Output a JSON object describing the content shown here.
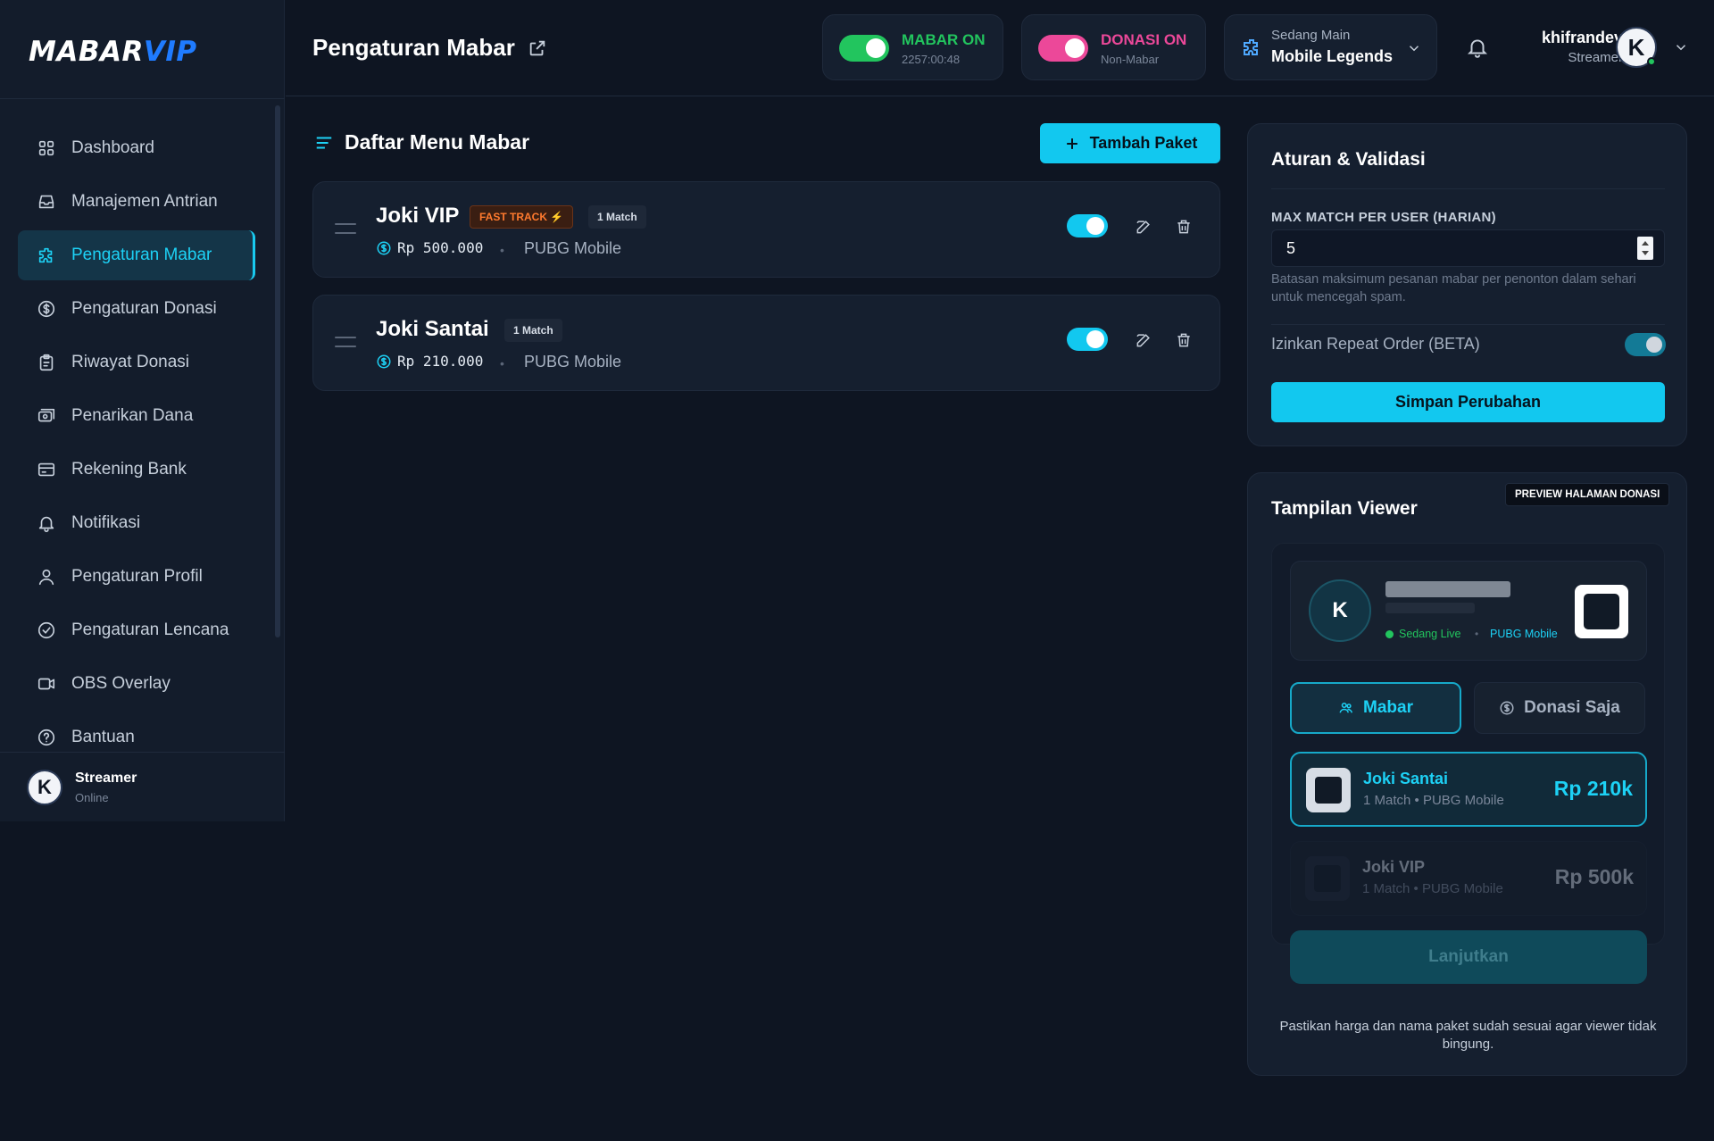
{
  "logo": {
    "part1": "MABAR",
    "part2": "VIP"
  },
  "sidebar": {
    "items": [
      {
        "label": "Dashboard",
        "icon": "grid-icon"
      },
      {
        "label": "Manajemen Antrian",
        "icon": "inbox-icon"
      },
      {
        "label": "Pengaturan Mabar",
        "icon": "puzzle-icon",
        "active": true
      },
      {
        "label": "Pengaturan Donasi",
        "icon": "dollar-circle-icon"
      },
      {
        "label": "Riwayat Donasi",
        "icon": "clipboard-icon"
      },
      {
        "label": "Penarikan Dana",
        "icon": "cash-icon"
      },
      {
        "label": "Rekening Bank",
        "icon": "card-icon"
      },
      {
        "label": "Notifikasi",
        "icon": "bell-icon"
      },
      {
        "label": "Pengaturan Profil",
        "icon": "user-icon"
      },
      {
        "label": "Pengaturan Lencana",
        "icon": "badge-check-icon"
      },
      {
        "label": "OBS Overlay",
        "icon": "video-icon"
      },
      {
        "label": "Bantuan",
        "icon": "help-icon"
      }
    ],
    "footer": {
      "avatar": "K",
      "name": "Streamer",
      "status": "Online"
    }
  },
  "header": {
    "title": "Pengaturan Mabar",
    "mabar": {
      "title": "MABAR ON",
      "sub": "2257:00:48",
      "color": "#22c55e"
    },
    "donasi": {
      "title": "DONASI ON",
      "sub": "Non-Mabar",
      "color": "#ec4899"
    },
    "playing": {
      "label": "Sedang Main",
      "game": "Mobile Legends"
    },
    "user": {
      "name": "khifrandev",
      "role": "Streamer",
      "avatar": "K"
    }
  },
  "main": {
    "title": "Daftar Menu Mabar",
    "add_button": "Tambah Paket",
    "packages": [
      {
        "name": "Joki VIP",
        "fast_track": "FAST TRACK ⚡",
        "match": "1 Match",
        "price": "Rp 500.000",
        "game": "PUBG Mobile",
        "enabled": true
      },
      {
        "name": "Joki Santai",
        "match": "1 Match",
        "price": "Rp 210.000",
        "game": "PUBG Mobile",
        "enabled": true
      }
    ]
  },
  "rules": {
    "title": "Aturan & Validasi",
    "max_label": "MAX MATCH PER USER (HARIAN)",
    "max_value": "5",
    "hint": "Batasan maksimum pesanan mabar per penonton dalam sehari untuk mencegah spam.",
    "repeat_label": "Izinkan Repeat Order (BETA)",
    "repeat_enabled": true,
    "save_button": "Simpan Perubahan"
  },
  "viewer": {
    "title": "Tampilan Viewer",
    "badge": "PREVIEW HALAMAN DONASI",
    "avatar": "K",
    "live": "Sedang Live",
    "game": "PUBG Mobile",
    "tab_mabar": "Mabar",
    "tab_donasi": "Donasi Saja",
    "packages": [
      {
        "name": "Joki Santai",
        "sub": "1 Match • PUBG Mobile",
        "price": "Rp 210k",
        "selected": true
      },
      {
        "name": "Joki VIP",
        "sub": "1 Match • PUBG Mobile",
        "price": "Rp 500k",
        "selected": false
      }
    ],
    "next_button": "Lanjutkan",
    "note": "Pastikan harga dan nama paket sudah sesuai agar viewer tidak bingung."
  },
  "colors": {
    "accent": "#12c8ef",
    "bg": "#0e1522",
    "panel": "#151f2f"
  }
}
